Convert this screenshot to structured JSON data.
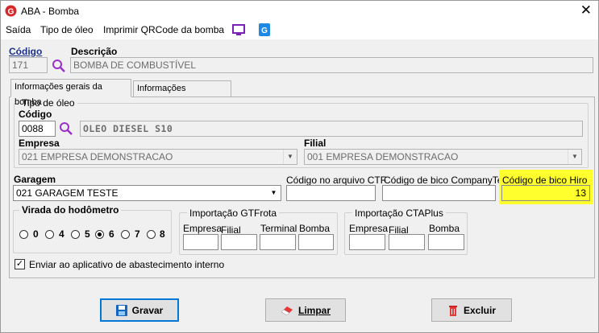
{
  "window": {
    "title": "ABA - Bomba"
  },
  "menu": {
    "exit": "Saída",
    "oil_type": "Tipo de óleo",
    "print_qr": "Imprimir QRCode da bomba"
  },
  "header": {
    "code_label": "Código",
    "code_value": "171",
    "description_label": "Descrição",
    "description_value": "BOMBA DE COMBUSTÍVEL"
  },
  "tabs": {
    "general": "Informações gerais da bomba",
    "fuel_station": "Informações eletroposto"
  },
  "oil_type": {
    "group_title": "Tipo de óleo",
    "code_label": "Código",
    "code_value": "0088",
    "name_value": "OLEO DIESEL S10",
    "company_label": "Empresa",
    "company_value": "021 EMPRESA DEMONSTRACAO",
    "branch_label": "Filial",
    "branch_value": "001 EMPRESA DEMONSTRACAO"
  },
  "garage": {
    "label": "Garagem",
    "value": "021 GARAGEM TESTE"
  },
  "ctf": {
    "label": "Código no arquivo CTF",
    "value": ""
  },
  "companytec": {
    "label": "Código de bico CompanyTec",
    "value": ""
  },
  "hiro": {
    "label": "Código de bico Hiro",
    "value": "13",
    "highlight_color": "#ffff2d"
  },
  "odometer": {
    "title": "Virada do hodômetro",
    "options": [
      "0",
      "4",
      "5",
      "6",
      "7",
      "8"
    ],
    "selected": "6"
  },
  "gtfrota": {
    "title": "Importação GTFrota",
    "company": "Empresa",
    "branch": "Filial",
    "terminal": "Terminal",
    "pump": "Bomba"
  },
  "ctaplus": {
    "title": "Importação CTAPlus",
    "company": "Empresa",
    "branch": "Filial",
    "pump": "Bomba"
  },
  "send_app": {
    "label": "Enviar ao aplicativo de abastecimento interno",
    "checked": true
  },
  "buttons": {
    "save": "Gravar",
    "clear": "Limpar",
    "delete": "Excluir"
  },
  "colors": {
    "accent": "#0078d7",
    "label_blue": "#1a2f8c",
    "search_purple": "#9b30c8"
  }
}
